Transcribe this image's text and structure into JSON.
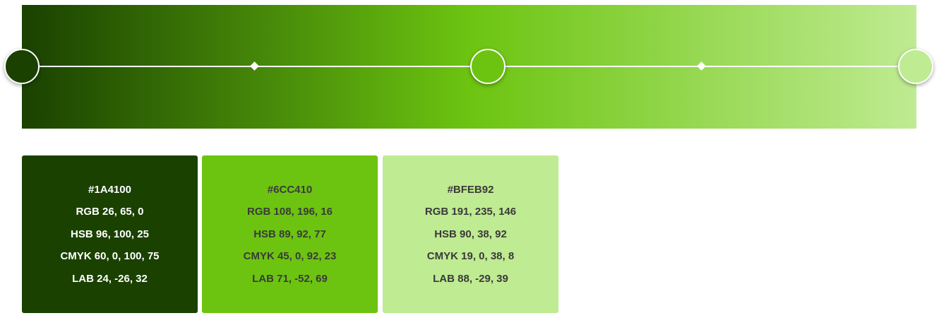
{
  "gradient": {
    "colors": [
      "#1A4100",
      "#6CC410",
      "#BFEB92"
    ],
    "stops": [
      {
        "name": "stop-1",
        "color": "#1A4100"
      },
      {
        "name": "stop-2",
        "color": "#6CC410"
      },
      {
        "name": "stop-3",
        "color": "#BFEB92"
      }
    ]
  },
  "swatches": [
    {
      "hex": "#1A4100",
      "rgb": "RGB 26, 65, 0",
      "hsb": "HSB 96, 100, 25",
      "cmyk": "CMYK 60, 0, 100, 75",
      "lab": "LAB 24, -26, 32",
      "text_color": "#ffffff"
    },
    {
      "hex": "#6CC410",
      "rgb": "RGB 108, 196, 16",
      "hsb": "HSB 89, 92, 77",
      "cmyk": "CMYK 45, 0, 92, 23",
      "lab": "LAB 71, -52, 69",
      "text_color": "#3a3a3a"
    },
    {
      "hex": "#BFEB92",
      "rgb": "RGB 191, 235, 146",
      "hsb": "HSB 90, 38, 92",
      "cmyk": "CMYK 19, 0, 38, 8",
      "lab": "LAB 88, -29, 39",
      "text_color": "#3a3a3a"
    }
  ]
}
